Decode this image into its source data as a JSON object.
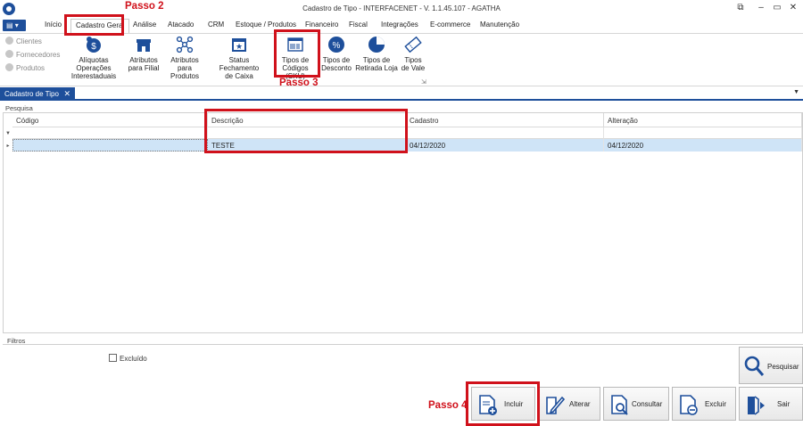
{
  "window": {
    "title": "Cadastro de Tipo - INTERFACENET - V. 1.1.45.107 - AGATHA",
    "menu_glyph": "▾"
  },
  "ribbon_tabs": [
    "Início",
    "Cadastro Geral",
    "Análise",
    "Atacado",
    "CRM",
    "Estoque / Produtos",
    "Financeiro",
    "Fiscal",
    "Integrações",
    "E-commerce",
    "Manutenção"
  ],
  "ribbon_side": [
    "Clientes",
    "Fornecedores",
    "Produtos"
  ],
  "ribbon_buttons": [
    {
      "line1": "Alíquotas Operações",
      "line2": "Interestaduais"
    },
    {
      "line1": "Atributos",
      "line2": "para Filial"
    },
    {
      "line1": "Atributos",
      "line2": "para Produtos"
    },
    {
      "line1": "Status Fechamento",
      "line2": "de Caixa"
    },
    {
      "line1": "Tipos de",
      "line2": "Códigos (SKU)"
    },
    {
      "line1": "Tipos de",
      "line2": "Desconto"
    },
    {
      "line1": "Tipos de",
      "line2": "Retirada Loja"
    },
    {
      "line1": "Tipos",
      "line2": "de Vale"
    }
  ],
  "doc_tab": {
    "label": "Cadastro de Tipo",
    "close": "✕"
  },
  "search": {
    "group_label": "Pesquisa",
    "columns": [
      "Código",
      "Descrição",
      "Cadastro",
      "Alteração"
    ],
    "rows": [
      {
        "codigo": "",
        "descricao": "TESTE",
        "cadastro": "04/12/2020",
        "alteracao": "04/12/2020"
      }
    ]
  },
  "filters": {
    "group_label": "Filtros",
    "excluido_label": "Excluído",
    "excluido_checked": false
  },
  "actions": {
    "pesquisar": "Pesquisar",
    "incluir": "Incluir",
    "alterar": "Alterar",
    "consultar": "Consultar",
    "excluir": "Excluir",
    "sair": "Sair"
  },
  "annotations": {
    "passo2": "Passo 2",
    "passo3": "Passo 3",
    "passo4": "Passo 4"
  },
  "colors": {
    "brand_blue": "#1e4f9b",
    "annotation_red": "#d0111b",
    "row_selected": "#cfe4f7"
  }
}
